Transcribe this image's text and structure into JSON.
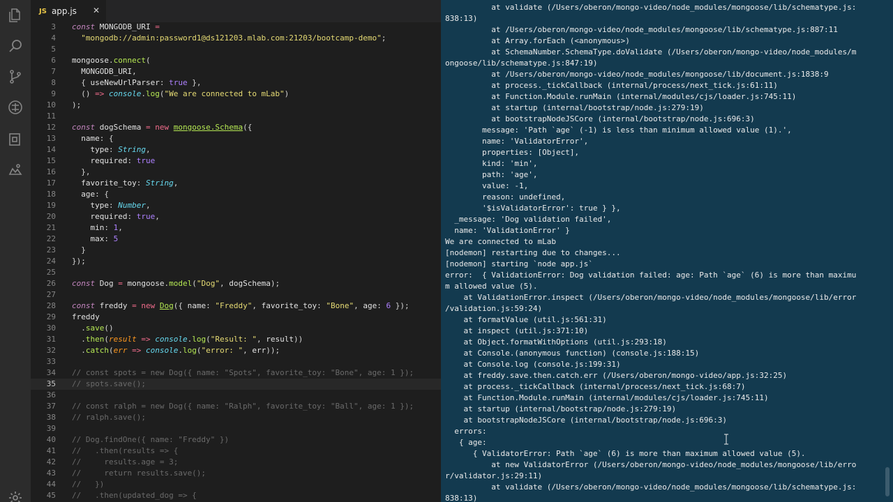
{
  "editor": {
    "tab": {
      "badge": "JS",
      "label": "app.js",
      "close": "✕"
    },
    "lines": [
      {
        "n": "3",
        "html": "<span class=\"kw\">const</span> <span class=\"var\">MONGODB_URI</span> <span class=\"op\">=</span>"
      },
      {
        "n": "4",
        "html": "  <span class=\"str\">\"mongodb://admin:password1@ds121203.mlab.com:21203/bootcamp-demo\"</span><span class=\"punc\">;</span>"
      },
      {
        "n": "5",
        "html": ""
      },
      {
        "n": "6",
        "html": "<span class=\"var\">mongoose</span><span class=\"punc\">.</span><span class=\"fn\">connect</span><span class=\"punc\">(</span>"
      },
      {
        "n": "7",
        "html": "  <span class=\"var\">MONGODB_URI</span><span class=\"punc\">,</span>"
      },
      {
        "n": "8",
        "html": "  <span class=\"punc\">{</span> <span class=\"prop\">useNewUrlParser</span><span class=\"punc\">:</span> <span class=\"bool\">true</span> <span class=\"punc\">},</span>"
      },
      {
        "n": "9",
        "html": "  <span class=\"punc\">()</span> <span class=\"op\">=&gt;</span> <span class=\"typ\">console</span><span class=\"punc\">.</span><span class=\"fn\">log</span><span class=\"punc\">(</span><span class=\"str\">\"We are connected to mLab\"</span><span class=\"punc\">)</span>"
      },
      {
        "n": "10",
        "html": "<span class=\"punc\">);</span>"
      },
      {
        "n": "11",
        "html": ""
      },
      {
        "n": "12",
        "html": "<span class=\"kw\">const</span> <span class=\"var\">dogSchema</span> <span class=\"op\">=</span> <span class=\"kw\" style=\"color:#f06c8b;font-style:normal\">new</span> <span class=\"fn u\">mongoose.Schema</span><span class=\"punc\">({</span>"
      },
      {
        "n": "13",
        "html": "  <span class=\"prop\">name</span><span class=\"punc\">: {</span>"
      },
      {
        "n": "14",
        "html": "    <span class=\"prop\">type</span><span class=\"punc\">:</span> <span class=\"typ\">String</span><span class=\"punc\">,</span>"
      },
      {
        "n": "15",
        "html": "    <span class=\"prop\">required</span><span class=\"punc\">:</span> <span class=\"bool\">true</span>"
      },
      {
        "n": "16",
        "html": "  <span class=\"punc\">},</span>"
      },
      {
        "n": "17",
        "html": "  <span class=\"prop\">favorite_toy</span><span class=\"punc\">:</span> <span class=\"typ\">String</span><span class=\"punc\">,</span>"
      },
      {
        "n": "18",
        "html": "  <span class=\"prop\">age</span><span class=\"punc\">: {</span>"
      },
      {
        "n": "19",
        "html": "    <span class=\"prop\">type</span><span class=\"punc\">:</span> <span class=\"typ\">Number</span><span class=\"punc\">,</span>"
      },
      {
        "n": "20",
        "html": "    <span class=\"prop\">required</span><span class=\"punc\">:</span> <span class=\"bool\">true</span><span class=\"punc\">,</span>"
      },
      {
        "n": "21",
        "html": "    <span class=\"prop\">min</span><span class=\"punc\">:</span> <span class=\"num\">1</span><span class=\"punc\">,</span>"
      },
      {
        "n": "22",
        "html": "    <span class=\"prop\">max</span><span class=\"punc\">:</span> <span class=\"num\">5</span>"
      },
      {
        "n": "23",
        "html": "  <span class=\"punc\">}</span>"
      },
      {
        "n": "24",
        "html": "<span class=\"punc\">});</span>"
      },
      {
        "n": "25",
        "html": ""
      },
      {
        "n": "26",
        "html": "<span class=\"kw\">const</span> <span class=\"var\">Dog</span> <span class=\"op\">=</span> <span class=\"var\">mongoose</span><span class=\"punc\">.</span><span class=\"fn\">model</span><span class=\"punc\">(</span><span class=\"str\">\"Dog\"</span><span class=\"punc\">,</span> <span class=\"var\">dogSchema</span><span class=\"punc\">);</span>"
      },
      {
        "n": "27",
        "html": ""
      },
      {
        "n": "28",
        "html": "<span class=\"kw\">const</span> <span class=\"var\">freddy</span> <span class=\"op\">=</span> <span class=\"kw\" style=\"color:#f06c8b;font-style:normal\">new</span> <span class=\"fn u\">Dog</span><span class=\"punc\">({</span> <span class=\"prop\">name</span><span class=\"punc\">:</span> <span class=\"str\">\"Freddy\"</span><span class=\"punc\">,</span> <span class=\"prop\">favorite_toy</span><span class=\"punc\">:</span> <span class=\"str\">\"Bone\"</span><span class=\"punc\">,</span> <span class=\"prop\">age</span><span class=\"punc\">:</span> <span class=\"num\">6</span> <span class=\"punc\">});</span>"
      },
      {
        "n": "29",
        "html": "<span class=\"var\">freddy</span>"
      },
      {
        "n": "30",
        "html": "  <span class=\"punc\">.</span><span class=\"fn\">save</span><span class=\"punc\">()</span>"
      },
      {
        "n": "31",
        "html": "  <span class=\"punc\">.</span><span class=\"fn\">then</span><span class=\"punc\">(</span><span class=\"param\">result</span> <span class=\"op\">=&gt;</span> <span class=\"typ\">console</span><span class=\"punc\">.</span><span class=\"fn\">log</span><span class=\"punc\">(</span><span class=\"str\">\"Result: \"</span><span class=\"punc\">,</span> <span class=\"var\">result</span><span class=\"punc\">))</span>"
      },
      {
        "n": "32",
        "html": "  <span class=\"punc\">.</span><span class=\"fn\">catch</span><span class=\"punc\">(</span><span class=\"param\">err</span> <span class=\"op\">=&gt;</span> <span class=\"typ\">console</span><span class=\"punc\">.</span><span class=\"fn\">log</span><span class=\"punc\">(</span><span class=\"str\">\"error: \"</span><span class=\"punc\">,</span> <span class=\"var\">err</span><span class=\"punc\">));</span>"
      },
      {
        "n": "33",
        "html": ""
      },
      {
        "n": "34",
        "html": "<span class=\"cmt\">// const spots = new Dog({ name: \"Spots\", favorite_toy: \"Bone\", age: 1 });</span>"
      },
      {
        "n": "35",
        "html": "<span class=\"cmt\">// spots.save();</span>",
        "active": true
      },
      {
        "n": "36",
        "html": ""
      },
      {
        "n": "37",
        "html": "<span class=\"cmt\">// const ralph = new Dog({ name: \"Ralph\", favorite_toy: \"Ball\", age: 1 });</span>"
      },
      {
        "n": "38",
        "html": "<span class=\"cmt\">// ralph.save();</span>"
      },
      {
        "n": "39",
        "html": ""
      },
      {
        "n": "40",
        "html": "<span class=\"cmt\">// Dog.findOne({ name: \"Freddy\" })</span>"
      },
      {
        "n": "41",
        "html": "<span class=\"cmt\">//   .then(results =&gt; {</span>"
      },
      {
        "n": "42",
        "html": "<span class=\"cmt\">//     results.age = 3;</span>"
      },
      {
        "n": "43",
        "html": "<span class=\"cmt\">//     return results.save();</span>"
      },
      {
        "n": "44",
        "html": "<span class=\"cmt\">//   })</span>"
      },
      {
        "n": "45",
        "html": "<span class=\"cmt\">//   .then(updated_dog =&gt; {</span>"
      }
    ]
  },
  "terminal": {
    "lines": [
      "          at validate (/Users/oberon/mongo-video/node_modules/mongoose/lib/schematype.js:",
      "838:13)",
      "          at /Users/oberon/mongo-video/node_modules/mongoose/lib/schematype.js:887:11",
      "          at Array.forEach (<anonymous>)",
      "          at SchemaNumber.SchemaType.doValidate (/Users/oberon/mongo-video/node_modules/m",
      "ongoose/lib/schematype.js:847:19)",
      "          at /Users/oberon/mongo-video/node_modules/mongoose/lib/document.js:1838:9",
      "          at process._tickCallback (internal/process/next_tick.js:61:11)",
      "          at Function.Module.runMain (internal/modules/cjs/loader.js:745:11)",
      "          at startup (internal/bootstrap/node.js:279:19)",
      "          at bootstrapNodeJSCore (internal/bootstrap/node.js:696:3)",
      "        message: 'Path `age` (-1) is less than minimum allowed value (1).',",
      "        name: 'ValidatorError',",
      "        properties: [Object],",
      "        kind: 'min',",
      "        path: 'age',",
      "        value: -1,",
      "        reason: undefined,",
      "        '$isValidatorError': true } },",
      "  _message: 'Dog validation failed',",
      "  name: 'ValidationError' }",
      "We are connected to mLab",
      "[nodemon] restarting due to changes...",
      "[nodemon] starting `node app.js`",
      "error:  { ValidationError: Dog validation failed: age: Path `age` (6) is more than maximu",
      "m allowed value (5).",
      "    at ValidationError.inspect (/Users/oberon/mongo-video/node_modules/mongoose/lib/error",
      "/validation.js:59:24)",
      "    at formatValue (util.js:561:31)",
      "    at inspect (util.js:371:10)",
      "    at Object.formatWithOptions (util.js:293:18)",
      "    at Console.(anonymous function) (console.js:188:15)",
      "    at Console.log (console.js:199:31)",
      "    at freddy.save.then.catch.err (/Users/oberon/mongo-video/app.js:32:25)",
      "    at process._tickCallback (internal/process/next_tick.js:68:7)",
      "    at Function.Module.runMain (internal/modules/cjs/loader.js:745:11)",
      "    at startup (internal/bootstrap/node.js:279:19)",
      "    at bootstrapNodeJSCore (internal/bootstrap/node.js:696:3)",
      "  errors:",
      "   { age:",
      "      { ValidatorError: Path `age` (6) is more than maximum allowed value (5).",
      "          at new ValidatorError (/Users/oberon/mongo-video/node_modules/mongoose/lib/erro",
      "r/validator.js:29:11)",
      "          at validate (/Users/oberon/mongo-video/node_modules/mongoose/lib/schematype.js:",
      "838:13)"
    ]
  },
  "activity_bar": {
    "icons": [
      "files-icon",
      "search-icon",
      "source-control-icon",
      "debug-icon",
      "extensions-icon",
      "remote-icon",
      "settings-gear-icon"
    ]
  },
  "colors": {
    "editor_bg": "#1e1e1e",
    "terminal_bg": "#133a4f",
    "activity_bg": "#2c2c2c"
  }
}
